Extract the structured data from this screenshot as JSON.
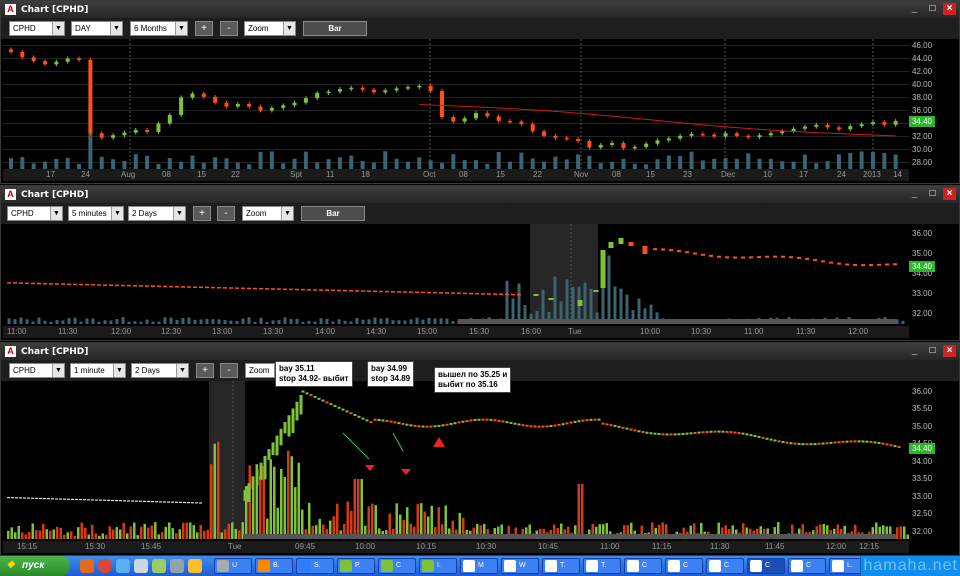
{
  "windows": [
    {
      "title": "Chart [CPHD]",
      "symbol": "CPHD",
      "interval": "DAY",
      "range": "6 Months",
      "zoom": "Zoom",
      "chart_type_button": "Bar",
      "plus": "+",
      "minus": "-",
      "yticks": [
        "46.00",
        "44.00",
        "42.00",
        "40.00",
        "38.00",
        "36.00",
        "34.00",
        "32.00",
        "30.00",
        "28.00"
      ],
      "last_price": "34.40",
      "xticks": [
        "17",
        "24",
        "Aug",
        "08",
        "15",
        "22",
        "Spt",
        "11",
        "18",
        "Oct",
        "08",
        "15",
        "22",
        "Nov",
        "08",
        "15",
        "23",
        "Dec",
        "10",
        "17",
        "24",
        "2013",
        "14"
      ]
    },
    {
      "title": "Chart [CPHD]",
      "symbol": "CPHD",
      "interval": "5 minutes",
      "range": "2 Days",
      "zoom": "Zoom",
      "chart_type_button": "Bar",
      "plus": "+",
      "minus": "-",
      "yticks": [
        "36.00",
        "35.00",
        "34.00",
        "33.00",
        "32.00"
      ],
      "last_price": "34.40",
      "xticks": [
        "11:00",
        "11:30",
        "12:00",
        "12:30",
        "13:00",
        "13:30",
        "14:00",
        "14:30",
        "15:00",
        "15:30",
        "16:00",
        "Tue",
        "10:00",
        "10:30",
        "11:00",
        "11:30",
        "12:00"
      ]
    },
    {
      "title": "Chart [CPHD]",
      "symbol": "CPHD",
      "interval": "1 minute",
      "range": "2 Days",
      "zoom": "Zoom",
      "plus": "+",
      "minus": "-",
      "yticks": [
        "36.00",
        "35.50",
        "35.00",
        "34.50",
        "34.00",
        "33.50",
        "33.00",
        "32.50",
        "32.00"
      ],
      "last_price": "34.40",
      "xticks": [
        "15:15",
        "15:30",
        "15:45",
        "Tue",
        "09:45",
        "10:00",
        "10:15",
        "10:30",
        "10:45",
        "11:00",
        "11:15",
        "11:30",
        "11:45",
        "12:00",
        "12:15"
      ]
    }
  ],
  "annotations": {
    "a1": [
      "bay 35.11",
      "stop 34.92- выбит"
    ],
    "a2": [
      "bay 34.99",
      "stop 34.89"
    ],
    "a3": [
      "вышел по 35.25 и",
      "выбит по 35.16"
    ]
  },
  "taskbar": {
    "start_label": "пуск",
    "tasks": [
      "U",
      "B.",
      "S.",
      "P.",
      "C",
      "I.",
      "M",
      "W",
      "T.",
      "T.",
      "C",
      "C",
      "C",
      "C",
      "C",
      "L."
    ],
    "watermark": "hamaha.net"
  },
  "chart_data": [
    {
      "type": "candlestick",
      "title": "Chart [CPHD]",
      "interval": "DAY",
      "ylim": [
        27,
        47
      ],
      "yticks": [
        46,
        44,
        42,
        40,
        38,
        36,
        34,
        32,
        30,
        28
      ],
      "last_price": 34.4,
      "overlay": "moving average (red line)",
      "closes": [
        45,
        44.2,
        43.6,
        43.1,
        43.5,
        44,
        43.8,
        32.5,
        31.8,
        32.2,
        32.6,
        33,
        32.7,
        34,
        35.3,
        38,
        38.6,
        38.1,
        37.2,
        36.6,
        37,
        36.6,
        36,
        36.4,
        36.8,
        37.2,
        37.9,
        38.7,
        38.9,
        39.3,
        39.5,
        39.2,
        38.8,
        39.1,
        39.4,
        39.6,
        39.8,
        39,
        35,
        34.3,
        34.8,
        35.6,
        35.1,
        34.4,
        34.3,
        33.9,
        32.8,
        32.1,
        31.8,
        31.6,
        31.3,
        30.3,
        30.7,
        31,
        30.2,
        30.4,
        30.9,
        31.4,
        31.7,
        32.1,
        32.4,
        32.3,
        32,
        32.5,
        32.1,
        31.9,
        32.2,
        32.5,
        32.8,
        33.2,
        33.5,
        33.8,
        33.4,
        33.1,
        33.6,
        33.9,
        34.2,
        33.8,
        34.4
      ]
    },
    {
      "type": "candlestick",
      "title": "Chart [CPHD]",
      "interval": "5 minutes",
      "ylim": [
        31.5,
        36.5
      ],
      "yticks": [
        36,
        35,
        34,
        33,
        32
      ],
      "last_price": 34.4
    },
    {
      "type": "candlestick",
      "title": "Chart [CPHD]",
      "interval": "1 minute",
      "ylim": [
        31.8,
        36.3
      ],
      "yticks": [
        36,
        35.5,
        35,
        34.5,
        34,
        33.5,
        33,
        32.5,
        32
      ],
      "last_price": 34.4
    }
  ]
}
